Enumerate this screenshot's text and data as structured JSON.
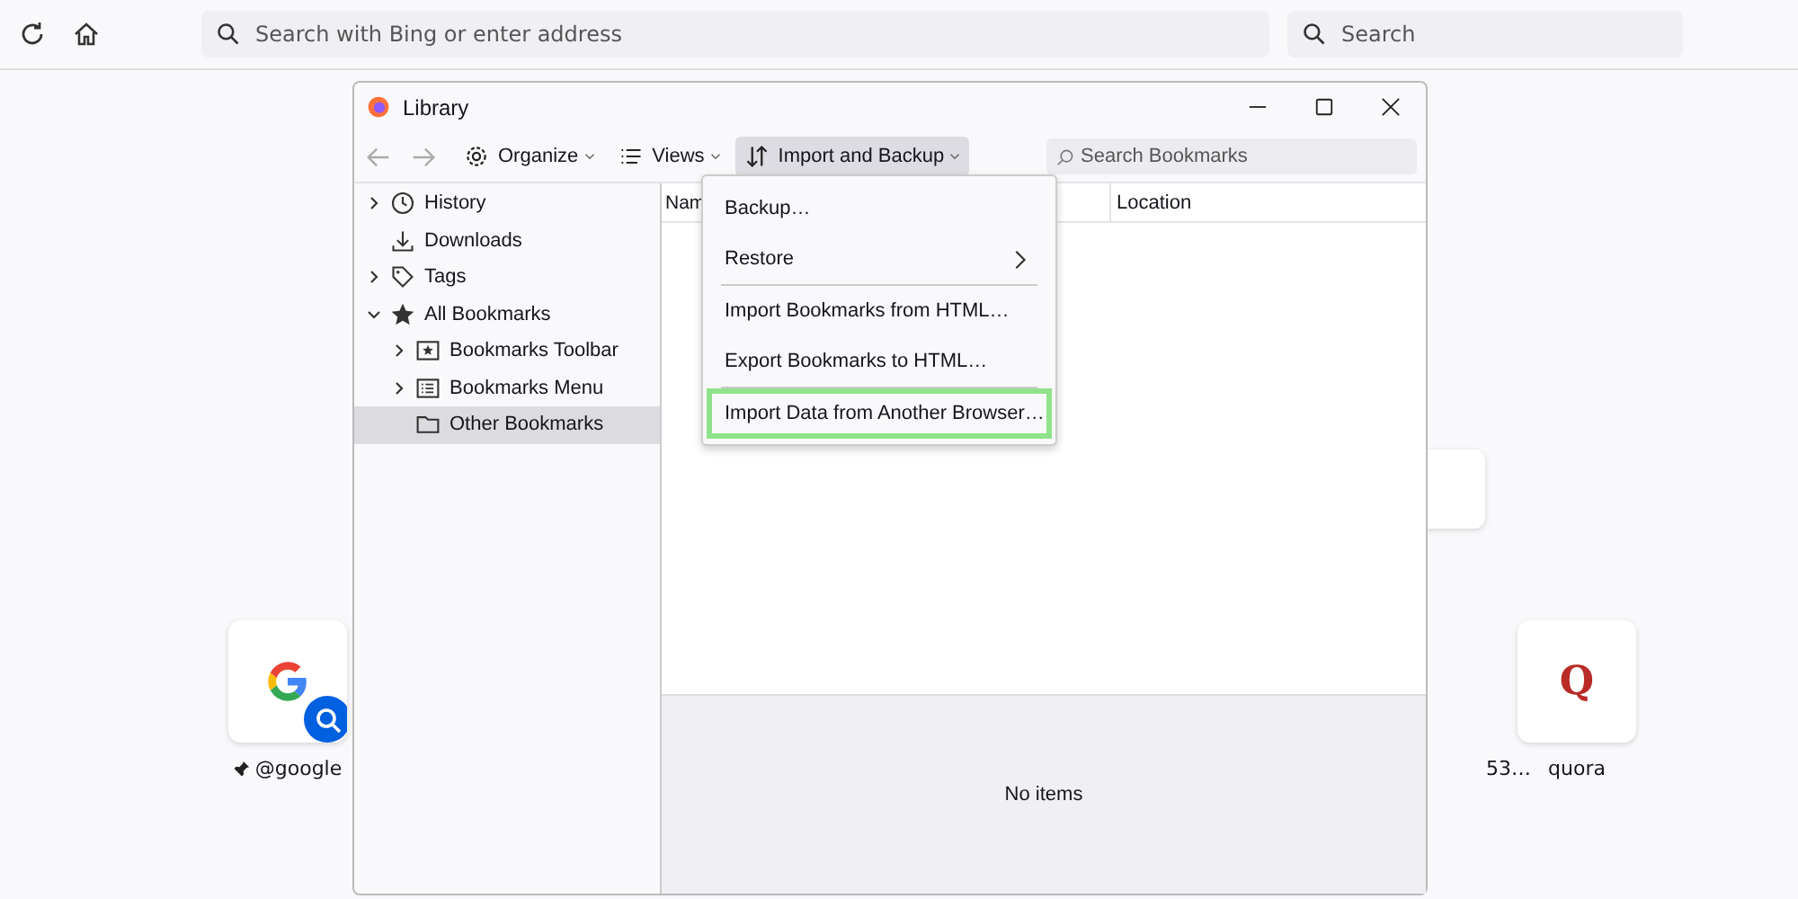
{
  "browser": {
    "address_placeholder": "Search with Bing or enter address",
    "search_placeholder": "Search"
  },
  "shortcuts": [
    {
      "label": "@google",
      "kind": "google",
      "pinned": true
    },
    {
      "label": "53…",
      "kind": "hidden",
      "pinned": false
    },
    {
      "label": "quora",
      "kind": "letter",
      "glyph": "Q",
      "pinned": false
    }
  ],
  "window": {
    "title": "Library"
  },
  "toolbar": {
    "buttons": [
      {
        "label": "Organize",
        "kind": "gear",
        "selected": false
      },
      {
        "label": "Views",
        "kind": "list",
        "selected": false
      },
      {
        "label": "Import and Backup",
        "kind": "sort",
        "selected": true
      }
    ],
    "search_placeholder": "Search Bookmarks"
  },
  "sidebar": {
    "items": [
      {
        "label": "History",
        "expanded": false,
        "selected": false
      },
      {
        "label": "Downloads",
        "selected": false
      },
      {
        "label": "Tags",
        "expanded": false,
        "selected": false
      },
      {
        "label": "All Bookmarks",
        "expanded": true,
        "selected": false,
        "children": [
          {
            "label": "Bookmarks Toolbar",
            "expanded": false,
            "selected": false
          },
          {
            "label": "Bookmarks Menu",
            "expanded": false,
            "selected": false
          },
          {
            "label": "Other Bookmarks",
            "selected": true
          }
        ]
      }
    ]
  },
  "table": {
    "columns": [
      "Nam",
      "Location"
    ]
  },
  "menu": {
    "items": [
      {
        "kind": "item",
        "label": "Backup…",
        "submenu": false,
        "highlighted": false
      },
      {
        "kind": "item",
        "label": "Restore",
        "submenu": true,
        "highlighted": false
      },
      {
        "kind": "separator"
      },
      {
        "kind": "item",
        "label": "Import Bookmarks from HTML…",
        "submenu": false,
        "highlighted": false
      },
      {
        "kind": "item",
        "label": "Export Bookmarks to HTML…",
        "submenu": false,
        "highlighted": false
      },
      {
        "kind": "separator"
      },
      {
        "kind": "item",
        "label": "Import Data from Another Browser…",
        "submenu": false,
        "highlighted": true
      }
    ]
  },
  "details": {
    "message": "No items"
  }
}
